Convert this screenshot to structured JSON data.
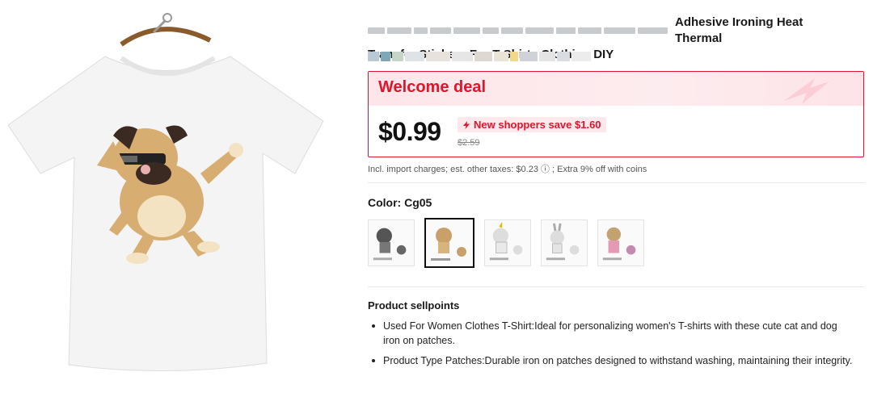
{
  "product": {
    "title_line1_visible": "Adhesive Ironing Heat Thermal",
    "title_line2": "Transfer Stickers For T Shirts Clothing DIY"
  },
  "deal": {
    "label": "Welcome deal",
    "price": "$0.99",
    "promo": "New shoppers save $1.60",
    "original_price": "$2.59"
  },
  "tax_note": "Incl. import charges; est. other taxes: $0.23 ⓘ ; Extra 9% off with coins",
  "color": {
    "label": "Color: Cg05",
    "selected_index": 1,
    "swatches": [
      "cat-patch-swatch",
      "pug-patch-swatch",
      "unicorn-patch-swatch",
      "rabbit-patch-swatch",
      "girl-patch-swatch"
    ]
  },
  "sellpoints": {
    "title": "Product sellpoints",
    "items": [
      "Used For Women Clothes T-Shirt:Ideal for personalizing women's T-shirts with these cute cat and dog iron on patches.",
      "Product Type Patches:Durable iron on patches designed to withstand washing, maintaining their integrity."
    ]
  },
  "colors": {
    "accent": "#e0142a",
    "deal_bg": "#fde6ea"
  }
}
